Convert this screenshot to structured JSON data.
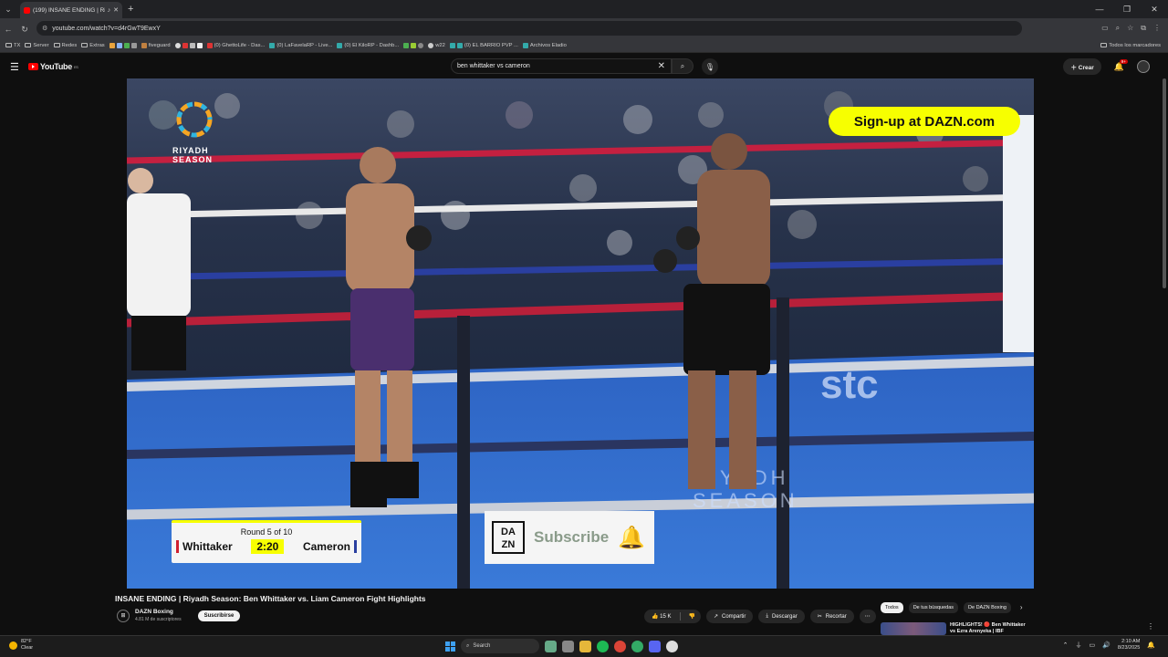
{
  "browser": {
    "tab_title": "(199) INSANE ENDING | Ri...",
    "url": "youtube.com/watch?v=d4rGwT9EwxY",
    "bookmarks": [
      "TX",
      "Server",
      "Redes",
      "Extras",
      "fiveguard",
      "(0) GhettoLife - Das...",
      "(0) LaFavelaRP - Live...",
      "(0) El KiloRP - Dashb...",
      "w22",
      "(0) EL BARRIO PVP ...",
      "Archivos Eladio"
    ],
    "all_bookmarks": "Todos los marcadores"
  },
  "youtube": {
    "logo_text": "YouTube",
    "logo_country": "ES",
    "search_value": "ben whittaker vs cameron",
    "create_label": "Crear",
    "notif_count": "9+"
  },
  "video": {
    "brand_text": "RIYADH\nSEASON",
    "promo": "Sign-up at DAZN.com",
    "round": "Round 5 of 10",
    "fighter_left": "Whittaker",
    "fighter_right": "Cameron",
    "clock": "2:20",
    "dazn_logo": "DA\nZN",
    "subscribe": "Subscribe",
    "floor_ad": "RIYADH\nSEASON"
  },
  "info": {
    "title": "INSANE ENDING | Riyadh Season: Ben Whittaker vs. Liam Cameron Fight Highlights",
    "channel": "DAZN Boxing",
    "subscribers": "4.81 M de suscriptores",
    "subscribe_btn": "Suscribirse",
    "likes": "15 K",
    "share": "Compartir",
    "download": "Descargar",
    "clip": "Recortar"
  },
  "chips": [
    "Todos",
    "De tus búsquedas",
    "De DAZN Boxing"
  ],
  "recommended": {
    "title_line1": "HIGHLIGHTS! 🔴 Ben Whittaker",
    "title_line2": "vs Ezra Arenyeka | IBF"
  },
  "taskbar": {
    "temp": "82°F",
    "condition": "Clear",
    "search": "Search",
    "time": "2:10 AM",
    "date": "8/23/2025"
  },
  "colors": {
    "youtube_red": "#ff0000",
    "dazn_yellow": "#f7ff00",
    "ring_canvas": "#2e66c8"
  }
}
